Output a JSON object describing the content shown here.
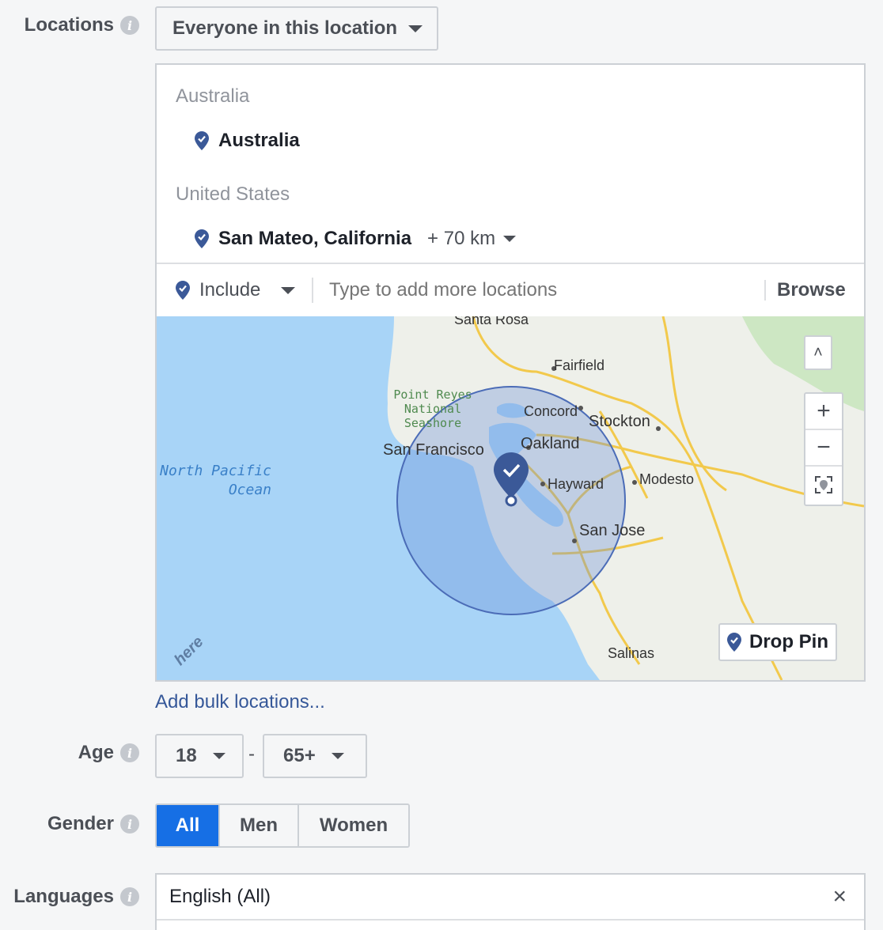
{
  "locations": {
    "label": "Locations",
    "audience_dropdown": "Everyone in this location",
    "groups": [
      {
        "country": "Australia",
        "items": [
          {
            "name": "Australia",
            "radius": ""
          }
        ]
      },
      {
        "country": "United States",
        "items": [
          {
            "name": "San Mateo, California",
            "radius": "+ 70 km"
          }
        ]
      }
    ],
    "include_label": "Include",
    "search_placeholder": "Type to add more locations",
    "browse_label": "Browse",
    "map": {
      "places": [
        "Santa Rosa",
        "Fairfield",
        "Point Reyes National Seashore",
        "Concord",
        "Stockton",
        "San Francisco",
        "Oakland",
        "North Pacific Ocean",
        "Hayward",
        "Modesto",
        "San Jose",
        "Salinas"
      ],
      "zoom_in": "+",
      "zoom_out": "−",
      "collapse": "˄",
      "drop_pin_label": "Drop Pin",
      "watermark": "here"
    },
    "bulk_link": "Add bulk locations..."
  },
  "age": {
    "label": "Age",
    "min": "18",
    "separator": "-",
    "max": "65+"
  },
  "gender": {
    "label": "Gender",
    "options": [
      "All",
      "Men",
      "Women"
    ],
    "selected": "All"
  },
  "languages": {
    "label": "Languages",
    "value": "English (All)",
    "clear": "×"
  },
  "colors": {
    "accent": "#166fe5",
    "pin": "#3b5998",
    "link": "#365899",
    "water": "#a8d4f7"
  }
}
